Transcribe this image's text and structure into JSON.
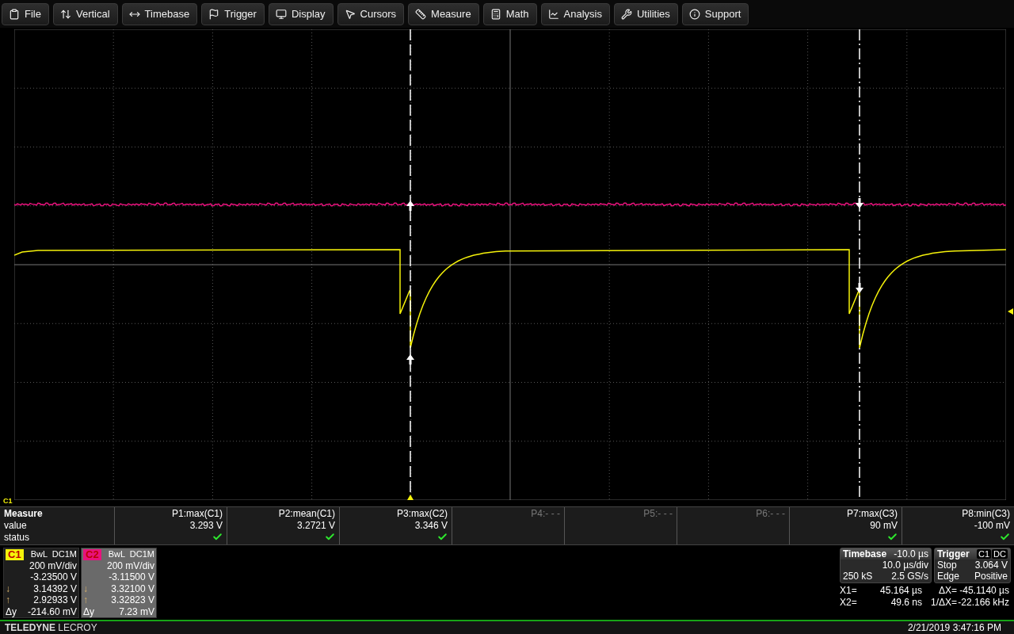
{
  "menu": [
    {
      "label": "File"
    },
    {
      "label": "Vertical"
    },
    {
      "label": "Timebase"
    },
    {
      "label": "Trigger"
    },
    {
      "label": "Display"
    },
    {
      "label": "Cursors"
    },
    {
      "label": "Measure"
    },
    {
      "label": "Math"
    },
    {
      "label": "Analysis"
    },
    {
      "label": "Utilities"
    },
    {
      "label": "Support"
    }
  ],
  "display": {
    "ground_marker": "C1"
  },
  "measure": {
    "title": "Measure",
    "row_labels": [
      "value",
      "status"
    ],
    "params": [
      {
        "name": "P1:max(C1)",
        "value": "3.293 V",
        "ok": true,
        "disabled": false
      },
      {
        "name": "P2:mean(C1)",
        "value": "3.2721 V",
        "ok": true,
        "disabled": false
      },
      {
        "name": "P3:max(C2)",
        "value": "3.346 V",
        "ok": true,
        "disabled": false
      },
      {
        "name": "P4:- - -",
        "disabled": true,
        "ok": false
      },
      {
        "name": "P5:- - -",
        "disabled": true,
        "ok": false
      },
      {
        "name": "P6:- - -",
        "disabled": true,
        "ok": false
      },
      {
        "name": "P7:max(C3)",
        "value": "90 mV",
        "ok": true,
        "disabled": false
      },
      {
        "name": "P8:min(C3)",
        "value": "-100 mV",
        "ok": true,
        "disabled": false
      }
    ]
  },
  "channels": [
    {
      "label": "C1",
      "color": "#f5f20a",
      "selected": false,
      "coupling": "BwL  DC1M",
      "scale": "200 mV/div",
      "offset": "-3.23500 V",
      "rows": [
        {
          "symbol": "↓",
          "value": "3.14392 V"
        },
        {
          "symbol": "↑",
          "value": "2.92933 V"
        },
        {
          "symbol": "Δy",
          "value": "-214.60 mV"
        }
      ]
    },
    {
      "label": "C2",
      "color": "#e8127c",
      "selected": true,
      "coupling": "BwL  DC1M",
      "scale": "200 mV/div",
      "offset": "-3.11500 V",
      "rows": [
        {
          "symbol": "↓",
          "value": "3.32100 V"
        },
        {
          "symbol": "↑",
          "value": "3.32823 V"
        },
        {
          "symbol": "Δy",
          "value": "7.23 mV"
        }
      ]
    }
  ],
  "timebase": {
    "title": "Timebase",
    "delay": "-10.0 µs",
    "per_div": "10.0 µs/div",
    "samples": "250 kS",
    "rate": "2.5 GS/s"
  },
  "trigger": {
    "title": "Trigger",
    "source": "C1",
    "coupling": "DC",
    "mode": "Stop",
    "level": "3.064 V",
    "type": "Edge",
    "slope": "Positive"
  },
  "cursor_readout": [
    {
      "label": "X1=",
      "value": "45.164 µs",
      "delta_label": "ΔX=",
      "delta_value": "-45.1140 µs"
    },
    {
      "label": "X2=",
      "value": "49.6 ns",
      "delta_label": "1/ΔX=",
      "delta_value": "-22.166 kHz"
    }
  ],
  "footer": {
    "brand_bold": "TELEDYNE",
    "brand": "LECROY",
    "datetime": "2/21/2019 3:47:16 PM"
  }
}
